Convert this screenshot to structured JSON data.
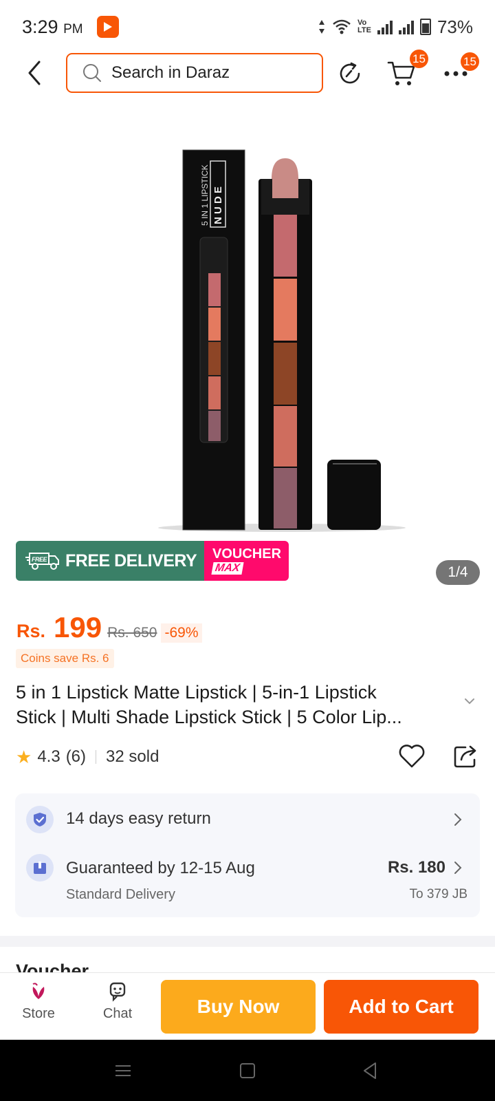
{
  "status_bar": {
    "time": "3:29",
    "ampm": "PM",
    "battery": "73%"
  },
  "header": {
    "search_placeholder": "Search in Daraz",
    "cart_count": "15",
    "more_count": "15"
  },
  "product_image": {
    "box_text": "5 IN 1 LIPSTICK",
    "brand_text": "N U D E",
    "pager": "1/4"
  },
  "promo": {
    "free_delivery": "FREE DELIVERY",
    "free_tag": "FREE",
    "voucher": "VOUCHER",
    "voucher_max": "MAX"
  },
  "price": {
    "currency": "Rs.",
    "current": "199",
    "original": "Rs. 650",
    "discount": "-69%",
    "coins": "Coins save Rs. 6"
  },
  "title": {
    "line1": "5 in 1 Lipstick Matte Lipstick | 5-in-1 Lipstick",
    "line2": "Stick | Multi Shade Lipstick Stick | 5 Color Lip..."
  },
  "rating": {
    "score": "4.3",
    "count": "(6)",
    "sold": "32 sold"
  },
  "services": {
    "return": "14 days easy return",
    "guarantee": "Guaranteed by 12-15 Aug",
    "delivery_type": "Standard Delivery",
    "delivery_price": "Rs. 180",
    "delivery_to": "To 379 JB"
  },
  "next_section_peek": "Voucher",
  "bottom_bar": {
    "store": "Store",
    "chat": "Chat",
    "buy_now": "Buy Now",
    "add_to_cart": "Add to Cart"
  },
  "colors": {
    "brand": "#f85606",
    "buy_now": "#fcaa1c",
    "free_delivery": "#3a8067",
    "voucher": "#ff0a6c",
    "star": "#fbaf1f"
  }
}
